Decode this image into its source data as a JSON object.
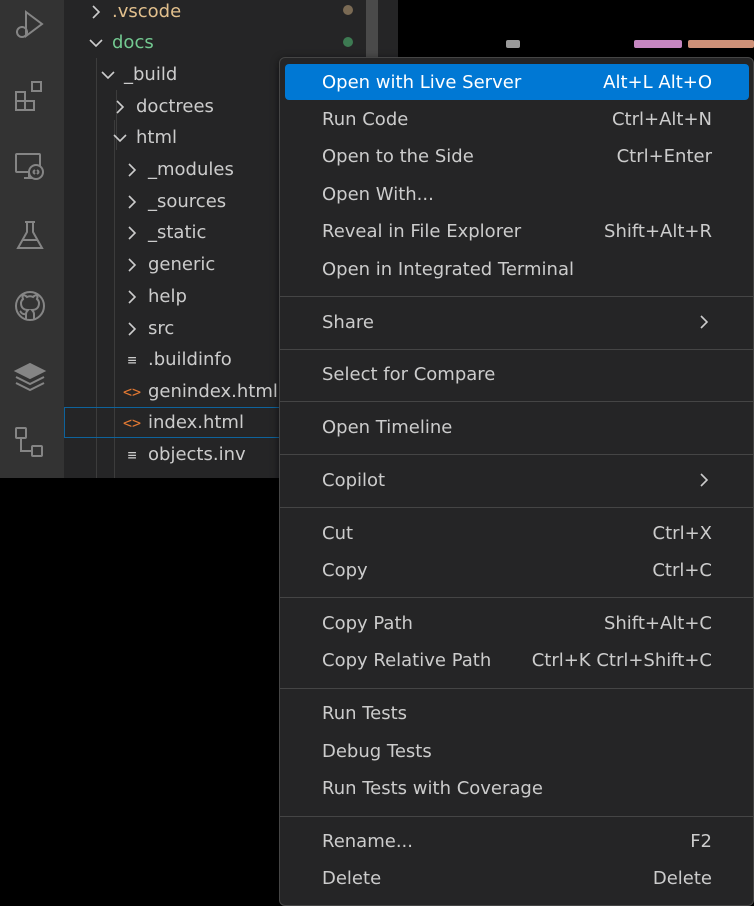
{
  "explorer": {
    "items": [
      {
        "label": ".vscode",
        "kind": "folder",
        "expanded": false,
        "color": "#e2c08d"
      },
      {
        "label": "docs",
        "kind": "folder",
        "expanded": true,
        "color": "#73c991"
      },
      {
        "label": "_build",
        "kind": "folder",
        "expanded": true,
        "color": "#cccccc"
      },
      {
        "label": "doctrees",
        "kind": "folder",
        "expanded": false,
        "color": "#cccccc"
      },
      {
        "label": "html",
        "kind": "folder",
        "expanded": true,
        "color": "#cccccc"
      },
      {
        "label": "_modules",
        "kind": "folder",
        "expanded": false,
        "color": "#cccccc"
      },
      {
        "label": "_sources",
        "kind": "folder",
        "expanded": false,
        "color": "#cccccc"
      },
      {
        "label": "_static",
        "kind": "folder",
        "expanded": false,
        "color": "#cccccc"
      },
      {
        "label": "generic",
        "kind": "folder",
        "expanded": false,
        "color": "#cccccc"
      },
      {
        "label": "help",
        "kind": "folder",
        "expanded": false,
        "color": "#cccccc"
      },
      {
        "label": "src",
        "kind": "folder",
        "expanded": false,
        "color": "#cccccc"
      },
      {
        "label": ".buildinfo",
        "kind": "text-file",
        "color": "#cccccc"
      },
      {
        "label": "genindex.html",
        "kind": "html-file",
        "color": "#cccccc"
      },
      {
        "label": "index.html",
        "kind": "html-file",
        "color": "#cccccc",
        "selected": true
      },
      {
        "label": "objects.inv",
        "kind": "text-file",
        "color": "#cccccc"
      }
    ],
    "status_colors": {
      "modified": "#7a6a54",
      "untracked": "#3d7a52"
    }
  },
  "activity_bar": {
    "icons": [
      "run-debug-icon",
      "extensions-icon",
      "remote-explorer-icon",
      "testing-icon",
      "github-icon",
      "layers-icon",
      "source-control-graph-icon"
    ]
  },
  "icons": {
    "html_glyph": "<>",
    "text_glyph": "≡"
  },
  "context_menu": {
    "groups": [
      [
        {
          "label": "Open with Live Server",
          "shortcut": "Alt+L Alt+O",
          "active": true
        },
        {
          "label": "Run Code",
          "shortcut": "Ctrl+Alt+N"
        },
        {
          "label": "Open to the Side",
          "shortcut": "Ctrl+Enter"
        },
        {
          "label": "Open With...",
          "shortcut": ""
        },
        {
          "label": "Reveal in File Explorer",
          "shortcut": "Shift+Alt+R"
        },
        {
          "label": "Open in Integrated Terminal",
          "shortcut": ""
        }
      ],
      [
        {
          "label": "Share",
          "shortcut": "",
          "submenu": true
        }
      ],
      [
        {
          "label": "Select for Compare",
          "shortcut": ""
        }
      ],
      [
        {
          "label": "Open Timeline",
          "shortcut": ""
        }
      ],
      [
        {
          "label": "Copilot",
          "shortcut": "",
          "submenu": true
        }
      ],
      [
        {
          "label": "Cut",
          "shortcut": "Ctrl+X"
        },
        {
          "label": "Copy",
          "shortcut": "Ctrl+C"
        }
      ],
      [
        {
          "label": "Copy Path",
          "shortcut": "Shift+Alt+C"
        },
        {
          "label": "Copy Relative Path",
          "shortcut": "Ctrl+K Ctrl+Shift+C"
        }
      ],
      [
        {
          "label": "Run Tests",
          "shortcut": ""
        },
        {
          "label": "Debug Tests",
          "shortcut": ""
        },
        {
          "label": "Run Tests with Coverage",
          "shortcut": ""
        }
      ],
      [
        {
          "label": "Rename...",
          "shortcut": "F2"
        },
        {
          "label": "Delete",
          "shortcut": "Delete"
        }
      ]
    ],
    "colors": {
      "highlight": "#0078d4",
      "background": "#252526",
      "text": "#cccccc"
    }
  }
}
